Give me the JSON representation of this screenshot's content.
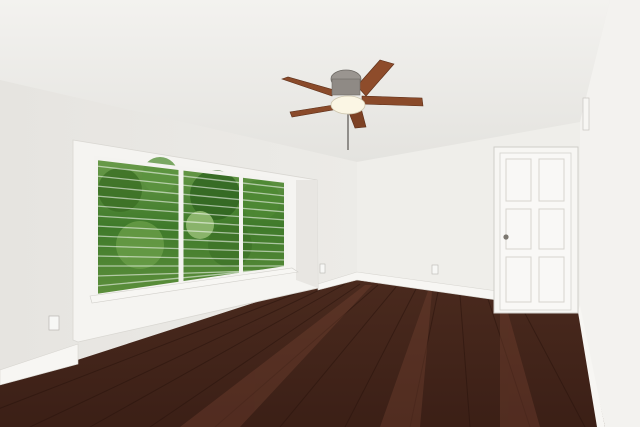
{
  "scene": {
    "description_type": "empty room interior photo",
    "colors": {
      "ceiling": "#f1f0ed",
      "wall_left": "#ebe9e5",
      "wall_back": "#eeedea",
      "wall_right": "#f2f1ee",
      "floor_dark": "#3a1f16",
      "floor_mid": "#5b3022",
      "floor_light": "#7a4634",
      "trim": "#f7f6f3",
      "fan_blade": "#8a4a2a",
      "fan_metal": "#9a9590",
      "foliage": "#4f8a33"
    },
    "objects": [
      "ceiling-fan",
      "window-with-blinds",
      "door",
      "baseboard",
      "hardwood-floor",
      "wall-outlet",
      "wall-vent"
    ]
  }
}
